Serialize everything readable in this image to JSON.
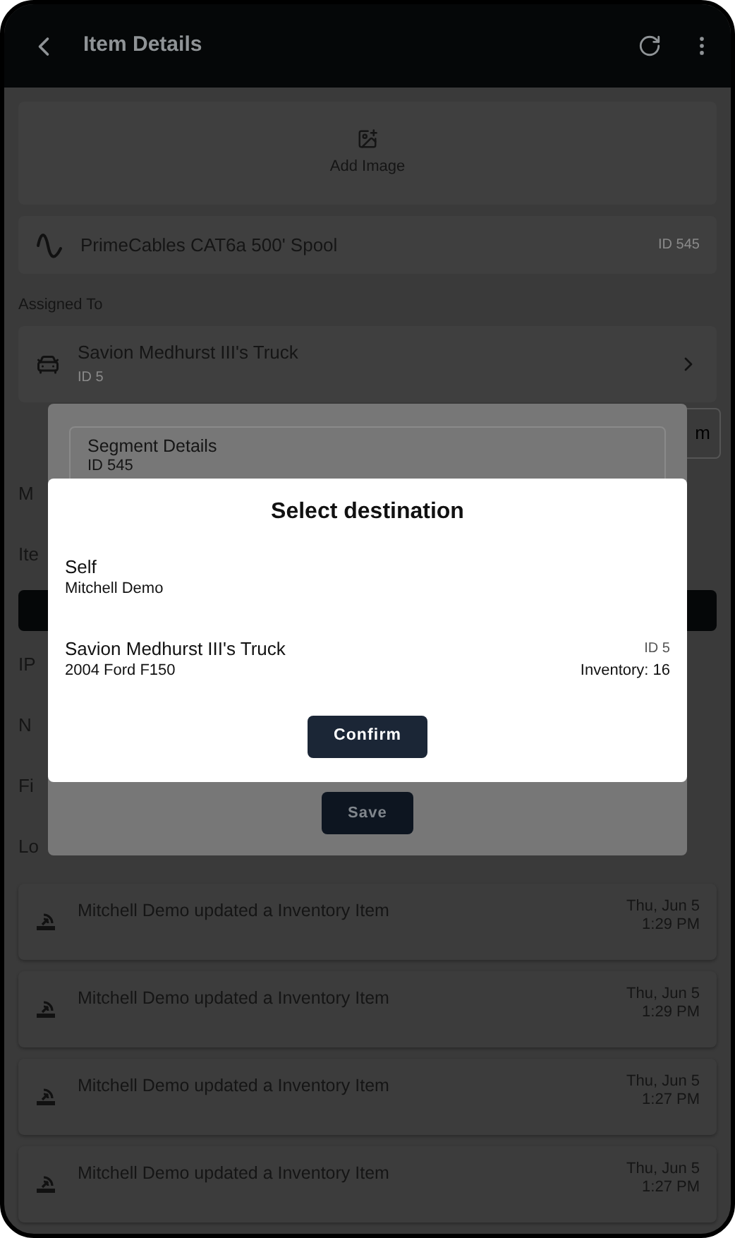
{
  "header": {
    "title": "Item Details"
  },
  "add_image": {
    "label": "Add Image"
  },
  "item": {
    "name": "PrimeCables CAT6a 500' Spool",
    "id": "ID 545"
  },
  "assigned": {
    "label": "Assigned To",
    "name": "Savion Medhurst III's Truck",
    "id": "ID 5"
  },
  "hidden_button": "m",
  "hidden_rows": [
    {
      "kind": "label",
      "text": "M"
    },
    {
      "kind": "label",
      "text": "Ite"
    },
    {
      "kind": "bar"
    },
    {
      "kind": "label",
      "text": "IP"
    },
    {
      "kind": "label",
      "text": "N"
    },
    {
      "kind": "label",
      "text": "Fi"
    },
    {
      "kind": "label",
      "text": "Lo"
    }
  ],
  "logs": [
    {
      "text": "Mitchell Demo updated a Inventory Item",
      "date": "Thu, Jun 5",
      "time": "1:29 PM"
    },
    {
      "text": "Mitchell Demo updated a Inventory Item",
      "date": "Thu, Jun 5",
      "time": "1:29 PM"
    },
    {
      "text": "Mitchell Demo updated a Inventory Item",
      "date": "Thu, Jun 5",
      "time": "1:27 PM"
    },
    {
      "text": "Mitchell Demo updated a Inventory Item",
      "date": "Thu, Jun 5",
      "time": "1:27 PM"
    }
  ],
  "segment_dialog": {
    "title": "Segment Details",
    "id": "ID 545",
    "save": "Save"
  },
  "destination_dialog": {
    "title": "Select destination",
    "options": [
      {
        "name": "Self",
        "subtitle": "Mitchell Demo"
      },
      {
        "name": "Savion Medhurst III's Truck",
        "subtitle": "2004 Ford F150",
        "id": "ID 5",
        "inventory": "Inventory: 16"
      }
    ],
    "confirm": "Confirm"
  }
}
